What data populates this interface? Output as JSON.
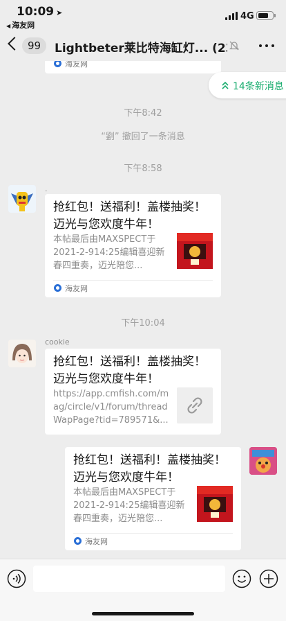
{
  "status": {
    "time": "10:09",
    "back_app": "海友网",
    "network": "4G"
  },
  "nav": {
    "unread_count": "99",
    "title": "Lightbeter莱比特海缸灯... (234)"
  },
  "new_messages": {
    "label": "14条新消息"
  },
  "messages": {
    "partial_card_source": "海友网",
    "time_1": "下午8:42",
    "recall_notice": "“劉” 撤回了一条消息",
    "time_2": "下午8:58",
    "card_1": {
      "sender": ".",
      "title": "抢红包！送福利！盖楼抽奖！迈光与您欢度牛年！",
      "desc": "本帖最后由MAXSPECT于2021-2-914:25编辑喜迎新春四重奏，迈光陪您...",
      "source": "海友网"
    },
    "time_3": "下午10:04",
    "card_2": {
      "sender": "cookie",
      "title": "抢红包！送福利！盖楼抽奖！迈光与您欢度牛年！",
      "desc": "https://app.cmfish.com/mag/circle/v1/forum/threadWapPage?tid=789571&..."
    },
    "card_3": {
      "title": "抢红包！送福利！盖楼抽奖！迈光与您欢度牛年！",
      "desc": "本帖最后由MAXSPECT于2021-2-914:25编辑喜迎新春四重奏，迈光陪您...",
      "source": "海友网"
    }
  },
  "colors": {
    "accent_green": "#1aad6f",
    "background": "#ededed"
  }
}
